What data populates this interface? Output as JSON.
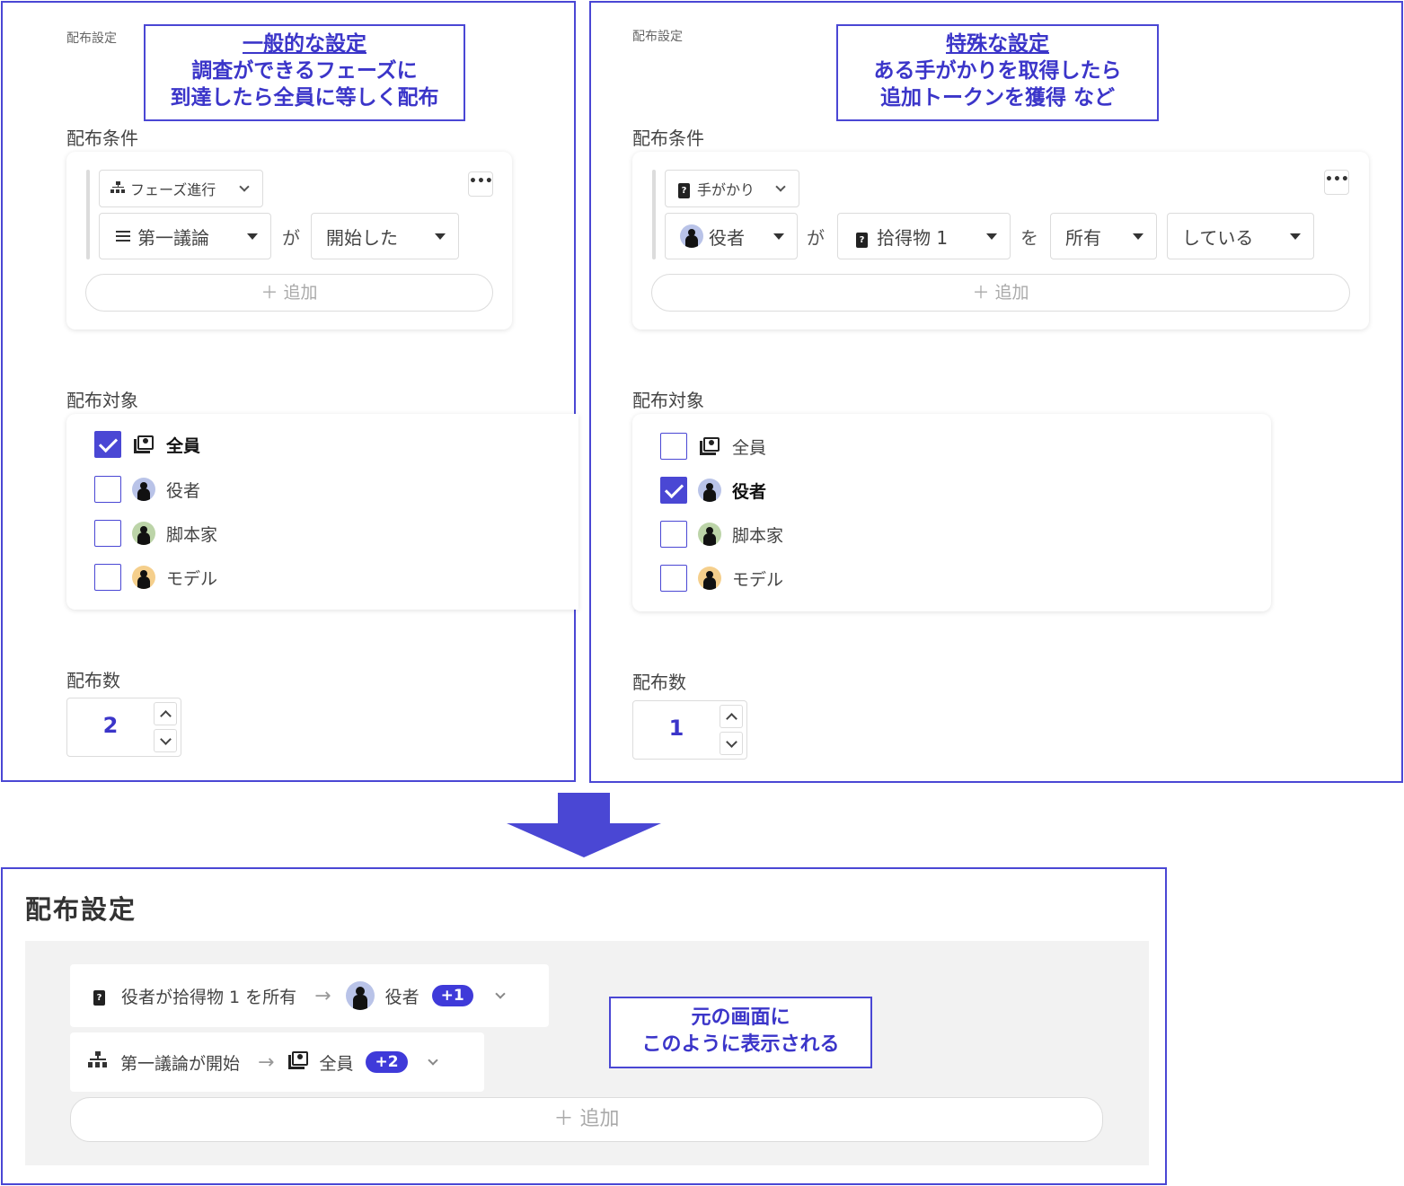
{
  "colors": {
    "accent": "#4a47d4",
    "badge": "#3f3ad9",
    "avatar_actor": "#b9c3e8",
    "avatar_writer": "#bcd4a8",
    "avatar_model": "#f5cf8c"
  },
  "left": {
    "small_title": "配布設定",
    "callout": {
      "head": "一般的な設定",
      "line1": "調査ができるフェーズに",
      "line2": "到達したら全員に等しく配布"
    },
    "condition_label": "配布条件",
    "condition": {
      "type_select": "フェーズ進行",
      "phase_select": "第一議論",
      "joiner": "が",
      "state_select": "開始した",
      "more": "•••",
      "add": "＋ 追加"
    },
    "target_label": "配布対象",
    "targets": [
      {
        "label": "全員",
        "checked": true,
        "icon": "group-icon"
      },
      {
        "label": "役者",
        "checked": false,
        "icon": "actor-avatar"
      },
      {
        "label": "脚本家",
        "checked": false,
        "icon": "writer-avatar"
      },
      {
        "label": "モデル",
        "checked": false,
        "icon": "model-avatar"
      }
    ],
    "count_label": "配布数",
    "count_value": "2"
  },
  "right": {
    "small_title": "配布設定",
    "callout": {
      "head": "特殊な設定",
      "line1": "ある手がかりを取得したら",
      "line2": "追加トークンを獲得 など"
    },
    "condition_label": "配布条件",
    "condition": {
      "type_select": "手がかり",
      "character_select": "役者",
      "joiner1": "が",
      "item_select": "拾得物 1",
      "joiner2": "を",
      "verb_select": "所有",
      "state_select": "している",
      "more": "•••",
      "add": "＋ 追加"
    },
    "target_label": "配布対象",
    "targets": [
      {
        "label": "全員",
        "checked": false,
        "icon": "group-icon"
      },
      {
        "label": "役者",
        "checked": true,
        "icon": "actor-avatar"
      },
      {
        "label": "脚本家",
        "checked": false,
        "icon": "writer-avatar"
      },
      {
        "label": "モデル",
        "checked": false,
        "icon": "model-avatar"
      }
    ],
    "count_label": "配布数",
    "count_value": "1"
  },
  "bottom": {
    "title": "配布設定",
    "rules": [
      {
        "condition": "役者が拾得物 1 を所有",
        "target": "役者",
        "extra": "+1"
      },
      {
        "condition": "第一議論が開始",
        "target": "全員",
        "extra": "+2"
      }
    ],
    "add": "＋ 追加",
    "callout": {
      "line1": "元の画面に",
      "line2": "このように表示される"
    }
  },
  "item_icon_glyph": "?"
}
